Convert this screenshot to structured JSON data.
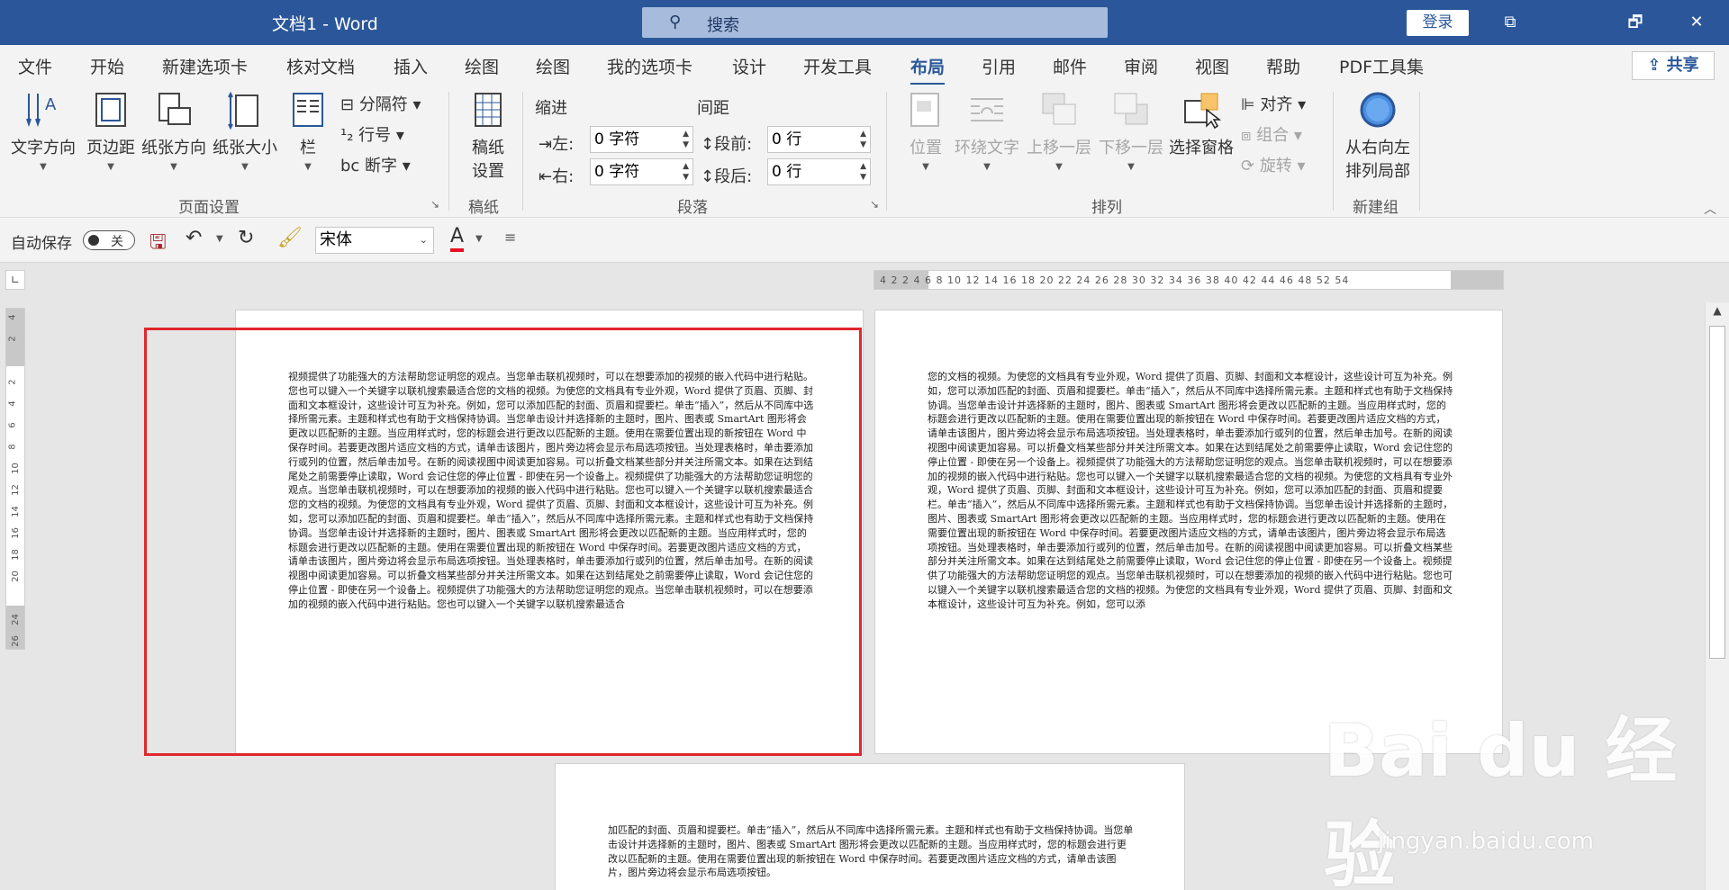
{
  "window": {
    "title": "文档1  -  Word",
    "search_placeholder": "搜索",
    "login": "登录",
    "buttons": [
      "⧉",
      "🗗",
      "✕"
    ]
  },
  "tabs": [
    "文件",
    "开始",
    "新建选项卡",
    "核对文档",
    "插入",
    "绘图",
    "绘图",
    "我的选项卡",
    "设计",
    "开发工具",
    "布局",
    "引用",
    "邮件",
    "审阅",
    "视图",
    "帮助",
    "PDF工具集"
  ],
  "active_tab": "布局",
  "share": "共享",
  "ribbon": {
    "page_setup": {
      "group": "页面设置",
      "text_direction": "文字方向",
      "margins": "页边距",
      "orientation": "纸张方向",
      "size": "纸张大小",
      "columns": "栏",
      "breaks": "分隔符",
      "line_numbers": "行号",
      "hyphenation": "断字"
    },
    "manuscript": {
      "group": "稿纸",
      "setup_line1": "稿纸",
      "setup_line2": "设置"
    },
    "paragraph": {
      "group": "段落",
      "indent": "缩进",
      "spacing": "间距",
      "left": "左:",
      "right": "右:",
      "before": "段前:",
      "after": "段后:",
      "left_value": "0 字符",
      "right_value": "0 字符",
      "before_value": "0 行",
      "after_value": "0 行"
    },
    "arrange": {
      "group": "排列",
      "position": "位置",
      "wrap_text": "环绕文字",
      "bring_forward": "上移一层",
      "send_backward": "下移一层",
      "selection_pane": "选择窗格",
      "align": "对齐",
      "group_btn": "组合",
      "rotate": "旋转"
    },
    "new_group": {
      "group": "新建组",
      "rtl_line1": "从右向左",
      "rtl_line2": "排列局部"
    }
  },
  "qat": {
    "autosave": "自动保存",
    "autosave_state": "关",
    "font": "宋体"
  },
  "ruler": {
    "h_numbers": "4  2     2   4   6   8  10  12  14  16  18  20  22  24  26  28  30  32  34  36  38  40  42  44  46  48     52  54",
    "v_numbers": [
      "4",
      "2",
      "",
      "2",
      "4",
      "6",
      "8",
      "10",
      "12",
      "14",
      "16",
      "18",
      "20",
      "",
      "24",
      "26"
    ]
  },
  "pages": {
    "page1": "视频提供了功能强大的方法帮助您证明您的观点。当您单击联机视频时，可以在想要添加的视频的嵌入代码中进行粘贴。您也可以键入一个关键字以联机搜索最适合您的文档的视频。为使您的文档具有专业外观，Word 提供了页眉、页脚、封面和文本框设计，这些设计可互为补充。例如，您可以添加匹配的封面、页眉和提要栏。单击“插入”，然后从不同库中选择所需元素。主题和样式也有助于文档保持协调。当您单击设计并选择新的主题时，图片、图表或 SmartArt 图形将会更改以匹配新的主题。当应用样式时，您的标题会进行更改以匹配新的主题。使用在需要位置出现的新按钮在 Word 中保存时间。若要更改图片适应文档的方式，请单击该图片，图片旁边将会显示布局选项按钮。当处理表格时，单击要添加行或列的位置，然后单击加号。在新的阅读视图中阅读更加容易。可以折叠文档某些部分并关注所需文本。如果在达到结尾处之前需要停止读取，Word 会记住您的停止位置 - 即使在另一个设备上。视频提供了功能强大的方法帮助您证明您的观点。当您单击联机视频时，可以在想要添加的视频的嵌入代码中进行粘贴。您也可以键入一个关键字以联机搜索最适合您的文档的视频。为使您的文档具有专业外观，Word 提供了页眉、页脚、封面和文本框设计，这些设计可互为补充。例如，您可以添加匹配的封面、页眉和提要栏。单击“插入”，然后从不同库中选择所需元素。主题和样式也有助于文档保持协调。当您单击设计并选择新的主题时，图片、图表或 SmartArt 图形将会更改以匹配新的主题。当应用样式时，您的标题会进行更改以匹配新的主题。使用在需要位置出现的新按钮在 Word 中保存时间。若要更改图片适应文档的方式，请单击该图片，图片旁边将会显示布局选项按钮。当处理表格时，单击要添加行或列的位置，然后单击加号。在新的阅读视图中阅读更加容易。可以折叠文档某些部分并关注所需文本。如果在达到结尾处之前需要停止读取，Word 会记住您的停止位置 - 即使在另一个设备上。视频提供了功能强大的方法帮助您证明您的观点。当您单击联机视频时，可以在想要添加的视频的嵌入代码中进行粘贴。您也可以键入一个关键字以联机搜索最适合",
    "page2": "您的文档的视频。为使您的文档具有专业外观，Word 提供了页眉、页脚、封面和文本框设计，这些设计可互为补充。例如，您可以添加匹配的封面、页眉和提要栏。单击“插入”，然后从不同库中选择所需元素。主题和样式也有助于文档保持协调。当您单击设计并选择新的主题时，图片、图表或 SmartArt 图形将会更改以匹配新的主题。当应用样式时，您的标题会进行更改以匹配新的主题。使用在需要位置出现的新按钮在 Word 中保存时间。若要更改图片适应文档的方式，请单击该图片，图片旁边将会显示布局选项按钮。当处理表格时，单击要添加行或列的位置，然后单击加号。在新的阅读视图中阅读更加容易。可以折叠文档某些部分并关注所需文本。如果在达到结尾处之前需要停止读取，Word 会记住您的停止位置 - 即使在另一个设备上。视频提供了功能强大的方法帮助您证明您的观点。当您单击联机视频时，可以在想要添加的视频的嵌入代码中进行粘贴。您也可以键入一个关键字以联机搜索最适合您的文档的视频。为使您的文档具有专业外观，Word 提供了页眉、页脚、封面和文本框设计，这些设计可互为补充。例如，您可以添加匹配的封面、页眉和提要栏。单击“插入”，然后从不同库中选择所需元素。主题和样式也有助于文档保持协调。当您单击设计并选择新的主题时，图片、图表或 SmartArt 图形将会更改以匹配新的主题。当应用样式时，您的标题会进行更改以匹配新的主题。使用在需要位置出现的新按钮在 Word 中保存时间。若要更改图片适应文档的方式，请单击该图片，图片旁边将会显示布局选项按钮。当处理表格时，单击要添加行或列的位置，然后单击加号。在新的阅读视图中阅读更加容易。可以折叠文档某些部分并关注所需文本。如果在达到结尾处之前需要停止读取，Word 会记住您的停止位置 - 即使在另一个设备上。视频提供了功能强大的方法帮助您证明您的观点。当您单击联机视频时，可以在想要添加的视频的嵌入代码中进行粘贴。您也可以键入一个关键字以联机搜索最适合您的文档的视频。为使您的文档具有专业外观，Word 提供了页眉、页脚、封面和文本框设计，这些设计可互为补充。例如，您可以添",
    "page3": "加匹配的封面、页眉和提要栏。单击“插入”，然后从不同库中选择所需元素。主题和样式也有助于文档保持协调。当您单击设计并选择新的主题时，图片、图表或 SmartArt 图形将会更改以匹配新的主题。当应用样式时，您的标题会进行更改以匹配新的主题。使用在需要位置出现的新按钮在 Word 中保存时间。若要更改图片适应文档的方式，请单击该图片，图片旁边将会显示布局选项按钮。"
  },
  "watermark": {
    "logo": "Bai du 经验",
    "url": "jingyan.baidu.com"
  },
  "colors": {
    "brand": "#2b579a",
    "highlight_box": "#e0272d"
  }
}
